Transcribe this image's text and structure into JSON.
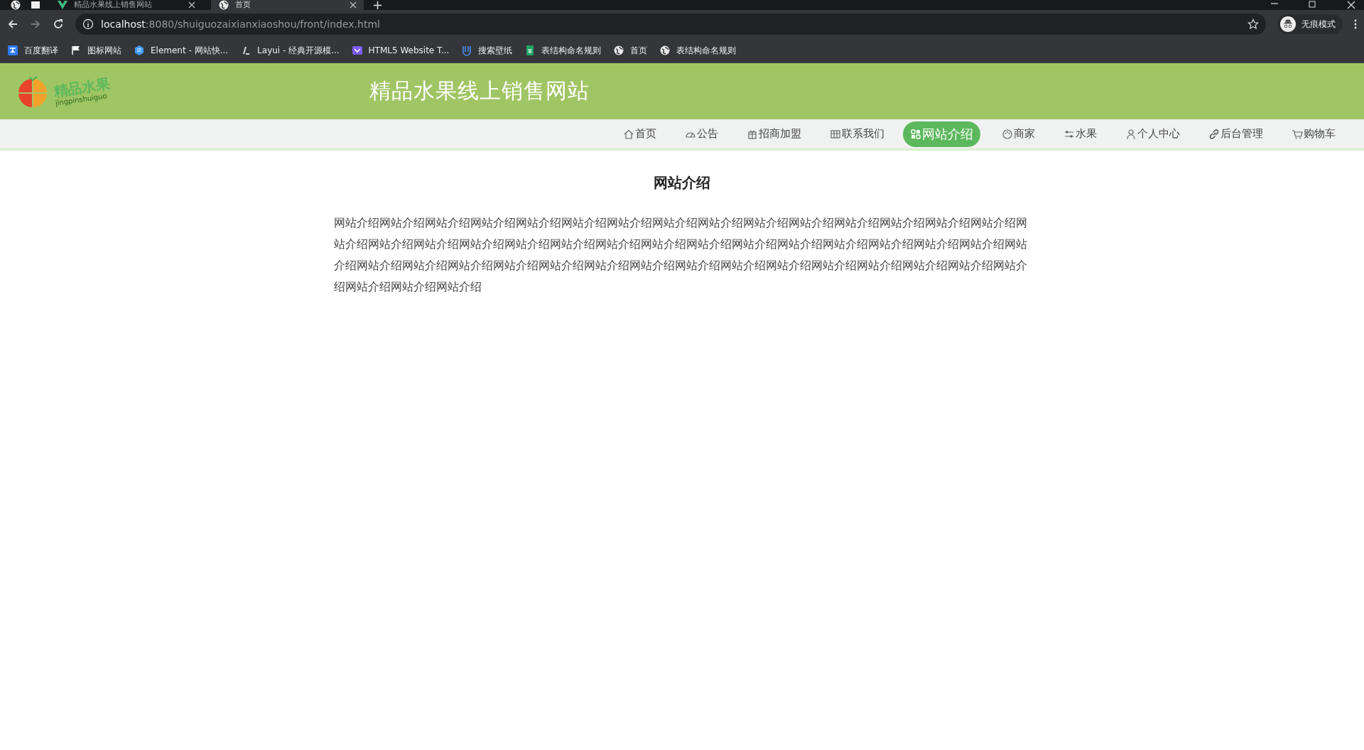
{
  "browser": {
    "tabs": [
      {
        "title": "精品水果线上销售网站",
        "selected": false
      },
      {
        "title": "首页",
        "selected": true
      }
    ],
    "new_tab": "+",
    "address": {
      "host": "localhost",
      "rest": ":8080/shuiguozaixianxiaoshou/front/index.html"
    },
    "profile": "无痕模式",
    "bookmarks": [
      "百度翻译",
      "图标网站",
      "Element - 网站快...",
      "Layui - 经典开源模...",
      "HTML5 Website T...",
      "搜索壁纸",
      "表结构命名规则",
      "首页",
      "表结构命名规则"
    ]
  },
  "header": {
    "logo_text": "精品水果",
    "logo_subtext": "jingpinshuiguo",
    "title": "精品水果线上销售网站"
  },
  "nav": [
    {
      "label": "首页",
      "selected": false
    },
    {
      "label": "公告",
      "selected": false
    },
    {
      "label": "招商加盟",
      "selected": false
    },
    {
      "label": "联系我们",
      "selected": false
    },
    {
      "label": "网站介绍",
      "selected": true
    },
    {
      "label": "商家",
      "selected": false
    },
    {
      "label": "水果",
      "selected": false
    },
    {
      "label": "个人中心",
      "selected": false
    },
    {
      "label": "后台管理",
      "selected": false
    },
    {
      "label": "购物车",
      "selected": false
    }
  ],
  "content": {
    "title": "网站介绍",
    "body": "网站介绍网站介绍网站介绍网站介绍网站介绍网站介绍网站介绍网站介绍网站介绍网站介绍网站介绍网站介绍网站介绍网站介绍网站介绍网站介绍网站介绍网站介绍网站介绍网站介绍网站介绍网站介绍网站介绍网站介绍网站介绍网站介绍网站介绍网站介绍网站介绍网站介绍网站介绍网站介绍网站介绍网站介绍网站介绍网站介绍网站介绍网站介绍网站介绍网站介绍网站介绍网站介绍网站介绍网站介绍网站介绍网站介绍网站介绍网站介绍网站介绍"
  }
}
